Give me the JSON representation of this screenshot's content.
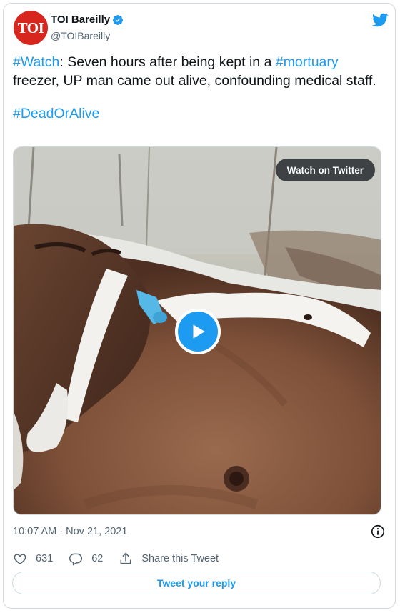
{
  "account": {
    "name": "TOI Bareilly",
    "handle": "@TOIBareilly",
    "avatar_text": "TOI"
  },
  "tweet": {
    "hashtag_watch": "#Watch",
    "text_part1": ": Seven hours after being kept in a ",
    "hashtag_mortuary": "#mortuary",
    "text_part2": " freezer, UP man came out alive, confounding medical staff.",
    "hashtag_deadoralive": "#DeadOrAlive"
  },
  "media": {
    "watch_label": "Watch on Twitter"
  },
  "meta": {
    "timestamp": "10:07 AM · Nov 21, 2021"
  },
  "actions": {
    "likes": "631",
    "replies": "62",
    "share_label": "Share this Tweet"
  },
  "reply_button": "Tweet your reply",
  "colors": {
    "accent": "#1d9bf0",
    "text": "#0f1419",
    "muted": "#536471",
    "border": "#cfd9de",
    "brand_red": "#d7261e"
  },
  "icons": [
    "verified-badge-icon",
    "twitter-bird-icon",
    "play-icon",
    "info-icon",
    "heart-icon",
    "reply-icon",
    "share-icon"
  ]
}
